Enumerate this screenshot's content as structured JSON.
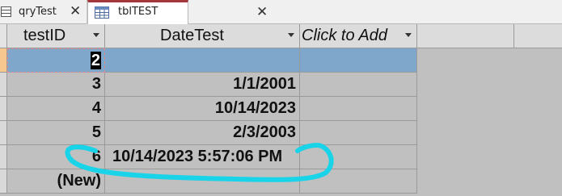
{
  "tabs": [
    {
      "label": "qryTest",
      "icon": "query-icon",
      "active": false
    },
    {
      "label": "tblTEST",
      "icon": "table-icon",
      "active": true
    }
  ],
  "columns": [
    {
      "label": "testID"
    },
    {
      "label": "DateTest"
    },
    {
      "label": "Click to Add"
    }
  ],
  "rows": [
    {
      "testID": "2",
      "DateTest": ""
    },
    {
      "testID": "3",
      "DateTest": "1/1/2001"
    },
    {
      "testID": "4",
      "DateTest": "10/14/2023"
    },
    {
      "testID": "5",
      "DateTest": "2/3/2003"
    },
    {
      "testID": "6",
      "DateTest": "10/14/2023 5:57:06 PM"
    },
    {
      "testID": "(New)",
      "DateTest": ""
    }
  ],
  "colors": {
    "selected_row": "#7fa7cb",
    "grid_bg": "#c0c0c0",
    "header_bg": "#dcdcdc",
    "active_tab_accent": "#a4373a",
    "annotation": "#19d3e8"
  }
}
